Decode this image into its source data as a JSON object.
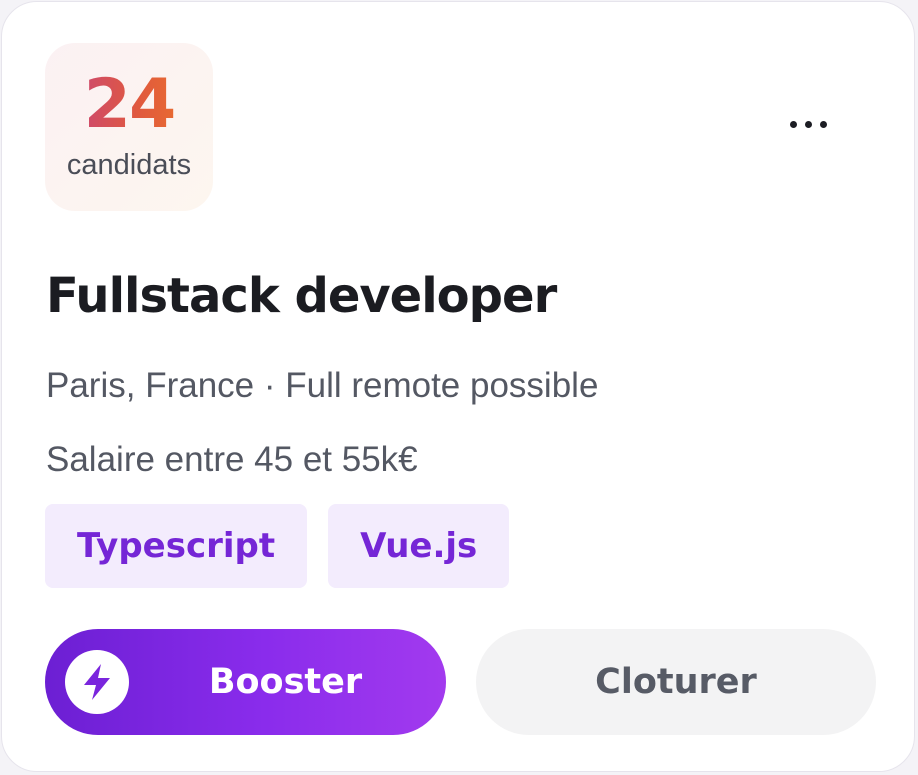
{
  "candidates": {
    "count": "24",
    "label": "candidats"
  },
  "job": {
    "title": "Fullstack developer",
    "location": "Paris, France · Full remote possible",
    "salary": "Salaire entre 45 et 55k€"
  },
  "tags": [
    "Typescript",
    "Vue.js"
  ],
  "actions": {
    "more_icon": "more-horizontal-icon",
    "booster_icon": "lightning-bolt-icon",
    "booster_label": "Booster",
    "close_label": "Cloturer"
  },
  "colors": {
    "accent_purple": "#8a2cec",
    "tag_text": "#7526d6",
    "tag_background": "#f3ecfd",
    "count_gradient_start": "#c2408a",
    "count_gradient_end": "#ef7a24",
    "secondary_button_background": "#f3f3f4"
  }
}
